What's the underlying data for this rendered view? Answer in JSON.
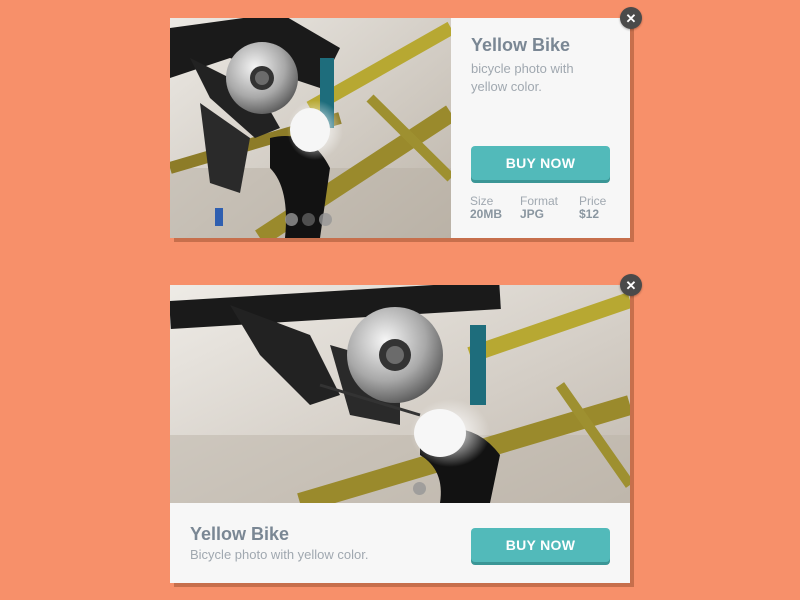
{
  "cards": [
    {
      "title": "Yellow Bike",
      "description": "bicycle photo with yellow color.",
      "buy_label": "BUY NOW",
      "close_label": "✕",
      "meta": [
        {
          "label": "Size",
          "value": "20MB"
        },
        {
          "label": "Format",
          "value": "JPG"
        },
        {
          "label": "Price",
          "value": "$12"
        }
      ],
      "slider": {
        "count": 3,
        "active_index": 1
      }
    },
    {
      "title": "Yellow Bike",
      "description": "Bicycle photo with yellow color.",
      "buy_label": "BUY NOW",
      "close_label": "✕",
      "slider": {
        "count": 1,
        "active_index": 0
      }
    }
  ],
  "colors": {
    "background": "#F7906A",
    "card": "#F7F7F7",
    "accent": "#52BABA",
    "accent_shadow": "#3B9696",
    "title": "#7A8794",
    "muted": "#A0A8B0",
    "close": "#4A4A4A"
  },
  "icons": {
    "close": "close-icon"
  }
}
